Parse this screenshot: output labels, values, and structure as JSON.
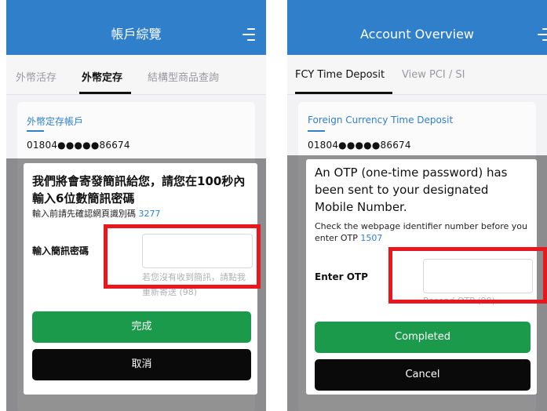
{
  "left": {
    "header": {
      "title": "帳戶綜覽",
      "menu_icon": "hamburger-menu-icon"
    },
    "tabs": [
      {
        "label": "外幣活存",
        "active": false
      },
      {
        "label": "外幣定存",
        "active": true
      },
      {
        "label": "結構型商品查詢",
        "active": false
      }
    ],
    "card": {
      "title": "外幣定存帳戶",
      "account_number": "01804●●●●●86674"
    },
    "dialog": {
      "message": "我們將會寄發簡訊給您，請您在100秒內輸入6位數簡訊密碼",
      "identifier_prefix": "輸入前請先確認網頁識別碼 ",
      "identifier_code": "3277",
      "otp_label": "輸入簡訊密碼",
      "otp_value": "",
      "resend_text": "若您沒有收到簡訊，請點我重新寄送 (98)",
      "confirm_label": "完成",
      "cancel_label": "取消"
    },
    "more_indicator": "..."
  },
  "right": {
    "header": {
      "title": "Account Overview",
      "menu_icon": "hamburger-menu-icon"
    },
    "tabs": [
      {
        "label": "FCY Time Deposit",
        "active": true
      },
      {
        "label": "View PCI / SI",
        "active": false
      }
    ],
    "card": {
      "title": "Foreign Currency Time Deposit",
      "account_number": "01804●●●●●86674"
    },
    "dialog": {
      "message": "An OTP (one-time password) has been sent to your designated Mobile Number.",
      "identifier_prefix": "Check the webpage identifier number before you enter OTP ",
      "identifier_code": "1507",
      "otp_label": "Enter OTP",
      "otp_value": "",
      "resend_text": "Resend OTP (98)",
      "confirm_label": "Completed",
      "cancel_label": "Cancel"
    }
  },
  "colors": {
    "header_blue": "#2f7fcb",
    "link_blue": "#2f7fcb",
    "confirm_green": "#1b9a4b",
    "cancel_black": "#0a0a0a",
    "highlight_red": "#e8161d"
  }
}
